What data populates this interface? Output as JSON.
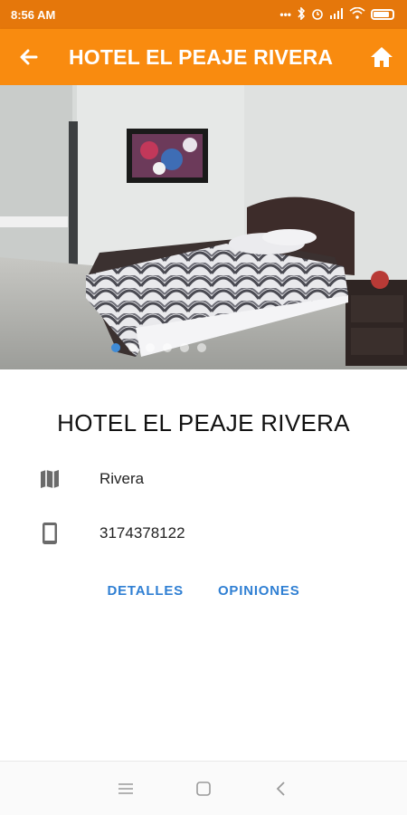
{
  "status_bar": {
    "time": "8:56 AM",
    "icons": [
      "dots-icon",
      "bluetooth-icon",
      "alarm-icon",
      "signal-icon",
      "wifi-icon",
      "battery-icon"
    ]
  },
  "app_bar": {
    "title": "HOTEL EL PEAJE RIVERA",
    "back_icon": "arrow-back-icon",
    "home_icon": "home-icon",
    "color": "#f98b0f"
  },
  "gallery": {
    "image": "hotel-room-photo",
    "page_count": 6,
    "active_index": 0,
    "active_dot_color": "#3f8bd6"
  },
  "hotel": {
    "name": "HOTEL EL PEAJE RIVERA",
    "location": "Rivera",
    "phone": "3174378122"
  },
  "actions": {
    "details_label": "DETALLES",
    "reviews_label": "OPINIONES",
    "color": "#2f7fd3"
  },
  "nav_bar": {
    "icons": [
      "menu-icon",
      "square-icon",
      "back-chevron-icon"
    ]
  }
}
